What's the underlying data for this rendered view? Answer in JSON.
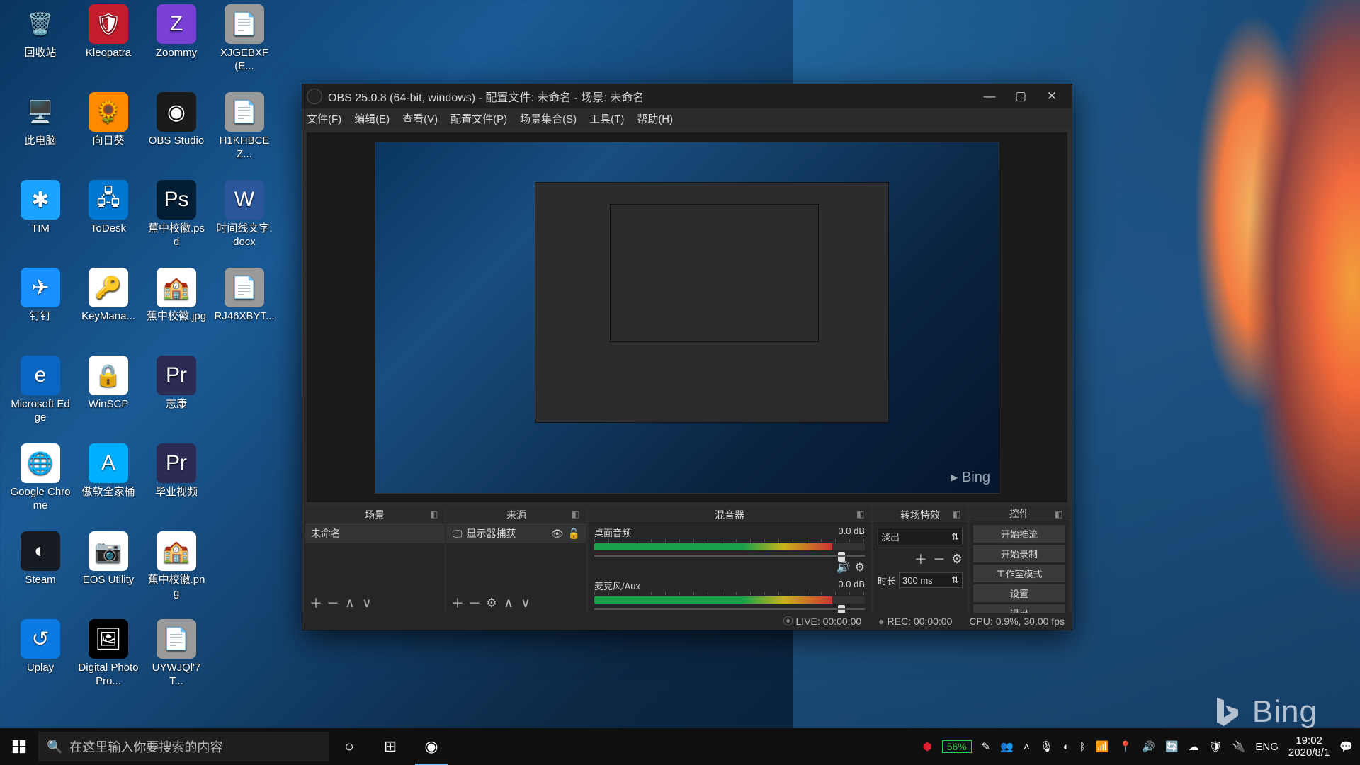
{
  "desktop": {
    "icons": [
      {
        "row": 0,
        "col": 0,
        "label": "回收站",
        "bg": "transparent",
        "glyph": "🗑️"
      },
      {
        "row": 0,
        "col": 1,
        "label": "Kleopatra",
        "bg": "#c41e2e",
        "glyph": "🛡"
      },
      {
        "row": 0,
        "col": 2,
        "label": "Zoommy",
        "bg": "#7a3fd4",
        "glyph": "Z"
      },
      {
        "row": 0,
        "col": 3,
        "label": "XJGEBXF(E...",
        "bg": "#9a9a9a",
        "glyph": "📄"
      },
      {
        "row": 1,
        "col": 0,
        "label": "此电脑",
        "bg": "transparent",
        "glyph": "🖥️"
      },
      {
        "row": 1,
        "col": 1,
        "label": "向日葵",
        "bg": "#ff8a00",
        "glyph": "🌻"
      },
      {
        "row": 1,
        "col": 2,
        "label": "OBS Studio",
        "bg": "#1b1b1b",
        "glyph": "◉"
      },
      {
        "row": 1,
        "col": 3,
        "label": "H1KHBCEZ...",
        "bg": "#9a9a9a",
        "glyph": "📄"
      },
      {
        "row": 2,
        "col": 0,
        "label": "TIM",
        "bg": "#1aa3ff",
        "glyph": "✱"
      },
      {
        "row": 2,
        "col": 1,
        "label": "ToDesk",
        "bg": "#0078d4",
        "glyph": "🖧"
      },
      {
        "row": 2,
        "col": 2,
        "label": "蕉中校徽.psd",
        "bg": "#001d34",
        "glyph": "Ps"
      },
      {
        "row": 2,
        "col": 3,
        "label": "时间线文字.docx",
        "bg": "#2b579a",
        "glyph": "W"
      },
      {
        "row": 3,
        "col": 0,
        "label": "钉钉",
        "bg": "#1890ff",
        "glyph": "✈"
      },
      {
        "row": 3,
        "col": 1,
        "label": "KeyMana...",
        "bg": "#ffffff",
        "glyph": "🔑"
      },
      {
        "row": 3,
        "col": 2,
        "label": "蕉中校徽.jpg",
        "bg": "#ffffff",
        "glyph": "🏫"
      },
      {
        "row": 3,
        "col": 3,
        "label": "RJ46XBYT...",
        "bg": "#9a9a9a",
        "glyph": "📄"
      },
      {
        "row": 4,
        "col": 0,
        "label": "Microsoft Edge",
        "bg": "#0a66c2",
        "glyph": "e"
      },
      {
        "row": 4,
        "col": 1,
        "label": "WinSCP",
        "bg": "#ffffff",
        "glyph": "🔒"
      },
      {
        "row": 4,
        "col": 2,
        "label": "志康",
        "bg": "#2b2b54",
        "glyph": "Pr"
      },
      {
        "row": 5,
        "col": 0,
        "label": "Google Chrome",
        "bg": "#ffffff",
        "glyph": "🌐"
      },
      {
        "row": 5,
        "col": 1,
        "label": "傲软全家桶",
        "bg": "#00b0ff",
        "glyph": "A"
      },
      {
        "row": 5,
        "col": 2,
        "label": "毕业视频",
        "bg": "#2b2b54",
        "glyph": "Pr"
      },
      {
        "row": 6,
        "col": 0,
        "label": "Steam",
        "bg": "#171a21",
        "glyph": "◐"
      },
      {
        "row": 6,
        "col": 1,
        "label": "EOS Utility",
        "bg": "#ffffff",
        "glyph": "📷"
      },
      {
        "row": 6,
        "col": 2,
        "label": "蕉中校徽.png",
        "bg": "#ffffff",
        "glyph": "🏫"
      },
      {
        "row": 7,
        "col": 0,
        "label": "Uplay",
        "bg": "#0a7be2",
        "glyph": "↺"
      },
      {
        "row": 7,
        "col": 1,
        "label": "Digital Photo Pro...",
        "bg": "#000000",
        "glyph": "🖼"
      },
      {
        "row": 7,
        "col": 2,
        "label": "UYWJQl'7T...",
        "bg": "#9a9a9a",
        "glyph": "📄"
      }
    ]
  },
  "bing": {
    "label": "Bing"
  },
  "obs": {
    "title": "OBS 25.0.8 (64-bit, windows) - 配置文件: 未命名 - 场景: 未命名",
    "menu": [
      "文件(F)",
      "编辑(E)",
      "查看(V)",
      "配置文件(P)",
      "场景集合(S)",
      "工具(T)",
      "帮助(H)"
    ],
    "docks": {
      "scenes": {
        "title": "场景",
        "item": "未命名"
      },
      "sources": {
        "title": "来源",
        "item": "显示器捕获"
      },
      "mixer": {
        "title": "混音器",
        "tracks": [
          {
            "name": "桌面音频",
            "db": "0.0 dB"
          },
          {
            "name": "麦克风/Aux",
            "db": "0.0 dB"
          }
        ]
      },
      "trans": {
        "title": "转场特效",
        "select": "淡出",
        "dur_label": "时长",
        "dur_val": "300 ms"
      },
      "controls": {
        "title": "控件",
        "buttons": [
          "开始推流",
          "开始录制",
          "工作室模式",
          "设置",
          "退出"
        ]
      }
    },
    "status": {
      "live": "LIVE: 00:00:00",
      "rec": "REC: 00:00:00",
      "cpu": "CPU: 0.9%, 30.00 fps"
    }
  },
  "taskbar": {
    "search_placeholder": "在这里输入你要搜索的内容",
    "battery": "56%",
    "lang": "ENG",
    "time": "19:02",
    "date": "2020/8/1"
  }
}
